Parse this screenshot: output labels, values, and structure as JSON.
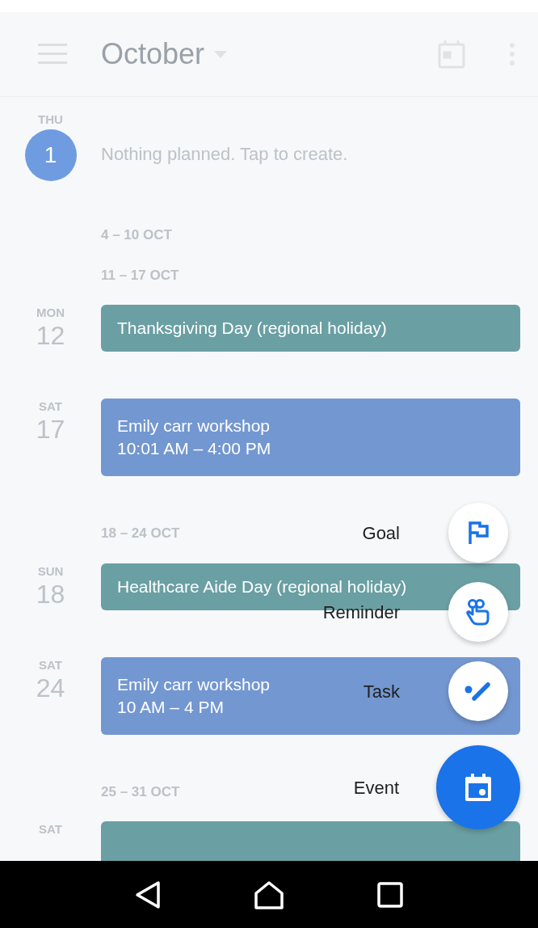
{
  "header": {
    "title": "October"
  },
  "agenda": [
    {
      "kind": "day",
      "day_name": "THU",
      "day_number": "1",
      "today": true,
      "empty_text": "Nothing planned. Tap to create."
    },
    {
      "kind": "week",
      "label": "4 – 10 OCT"
    },
    {
      "kind": "week",
      "label": "11 – 17 OCT"
    },
    {
      "kind": "day",
      "day_name": "MON",
      "day_number": "12",
      "today": false,
      "events": [
        {
          "title": "Thanksgiving Day (regional holiday)",
          "color": "#6a9fa3"
        }
      ]
    },
    {
      "kind": "day",
      "day_name": "SAT",
      "day_number": "17",
      "today": false,
      "events": [
        {
          "title": "Emily carr workshop",
          "time": "10:01 AM – 4:00 PM",
          "color": "#7397d0"
        }
      ]
    },
    {
      "kind": "week",
      "label": "18 – 24 OCT"
    },
    {
      "kind": "day",
      "day_name": "SUN",
      "day_number": "18",
      "today": false,
      "events": [
        {
          "title": "Healthcare Aide Day (regional holiday)",
          "color": "#6a9fa3"
        }
      ]
    },
    {
      "kind": "day",
      "day_name": "SAT",
      "day_number": "24",
      "today": false,
      "events": [
        {
          "title": "Emily carr workshop",
          "time": "10 AM – 4 PM",
          "color": "#7397d0"
        }
      ]
    },
    {
      "kind": "week",
      "label": "25 – 31 OCT"
    },
    {
      "kind": "day",
      "day_name": "SAT",
      "today": false,
      "events": [
        {
          "color": "#6a9fa3"
        }
      ]
    }
  ],
  "fab_menu": [
    {
      "kind": "goal",
      "label": "Goal"
    },
    {
      "kind": "reminder",
      "label": "Reminder"
    },
    {
      "kind": "task",
      "label": "Task"
    },
    {
      "kind": "event",
      "label": "Event"
    }
  ]
}
